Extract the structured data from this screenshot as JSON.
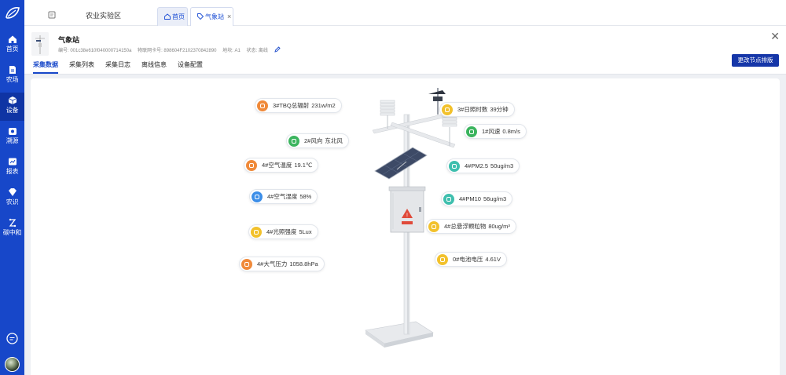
{
  "sidebar": {
    "items": [
      {
        "label": "首页",
        "icon": "home-icon"
      },
      {
        "label": "农场",
        "icon": "farm-icon"
      },
      {
        "label": "设备",
        "icon": "device-icon"
      },
      {
        "label": "溯源",
        "icon": "trace-icon"
      },
      {
        "label": "报表",
        "icon": "report-icon"
      },
      {
        "label": "农识",
        "icon": "knowledge-icon"
      },
      {
        "label": "碳中和",
        "icon": "carbon-icon"
      }
    ],
    "active_index": 2
  },
  "topbar": {
    "farm_select": "农业实验区",
    "tabs": [
      {
        "label": "首页"
      },
      {
        "label": "气象站"
      }
    ]
  },
  "device": {
    "name": "气象站",
    "meta": {
      "code": "编号: 001c38e610f040000714150a",
      "iot_card": "物联网卡号: 898604F2102370842890",
      "plot": "地块: A1",
      "status": "状态: 离线"
    }
  },
  "subtabs": [
    "采集数据",
    "采集列表",
    "采集日志",
    "离线信息",
    "设备配置"
  ],
  "actions": {
    "reorder_button": "更改节点排版"
  },
  "colors": {
    "primary": "#1747c9",
    "orange": "#f08a3a",
    "green": "#3bb45e",
    "blue": "#3c8ee8",
    "yellow": "#f2c12c",
    "teal": "#3fbfae"
  },
  "sensors": [
    {
      "name": "3#TBQ总辐射",
      "value": "231w/m2",
      "color": "orange",
      "side": "left"
    },
    {
      "name": "2#风向",
      "value": "东北风",
      "color": "green",
      "side": "left"
    },
    {
      "name": "4#空气温度",
      "value": "19.1℃",
      "color": "orange",
      "side": "left"
    },
    {
      "name": "4#空气湿度",
      "value": "58%",
      "color": "blue",
      "side": "left"
    },
    {
      "name": "4#光照强度",
      "value": "5Lux",
      "color": "yellow",
      "side": "left"
    },
    {
      "name": "4#大气压力",
      "value": "1058.8hPa",
      "color": "orange",
      "side": "left"
    },
    {
      "name": "3#日照时数",
      "value": "39分钟",
      "color": "yellow",
      "side": "right"
    },
    {
      "name": "1#风速",
      "value": "0.8m/s",
      "color": "green",
      "side": "right"
    },
    {
      "name": "4#PM2.5",
      "value": "50ug/m3",
      "color": "teal",
      "side": "right"
    },
    {
      "name": "4#PM10",
      "value": "56ug/m3",
      "color": "teal",
      "side": "right"
    },
    {
      "name": "4#总悬浮颗粒物",
      "value": "80ug/m³",
      "color": "yellow",
      "side": "right"
    },
    {
      "name": "0#电池电压",
      "value": "4.61V",
      "color": "yellow",
      "side": "right"
    }
  ]
}
